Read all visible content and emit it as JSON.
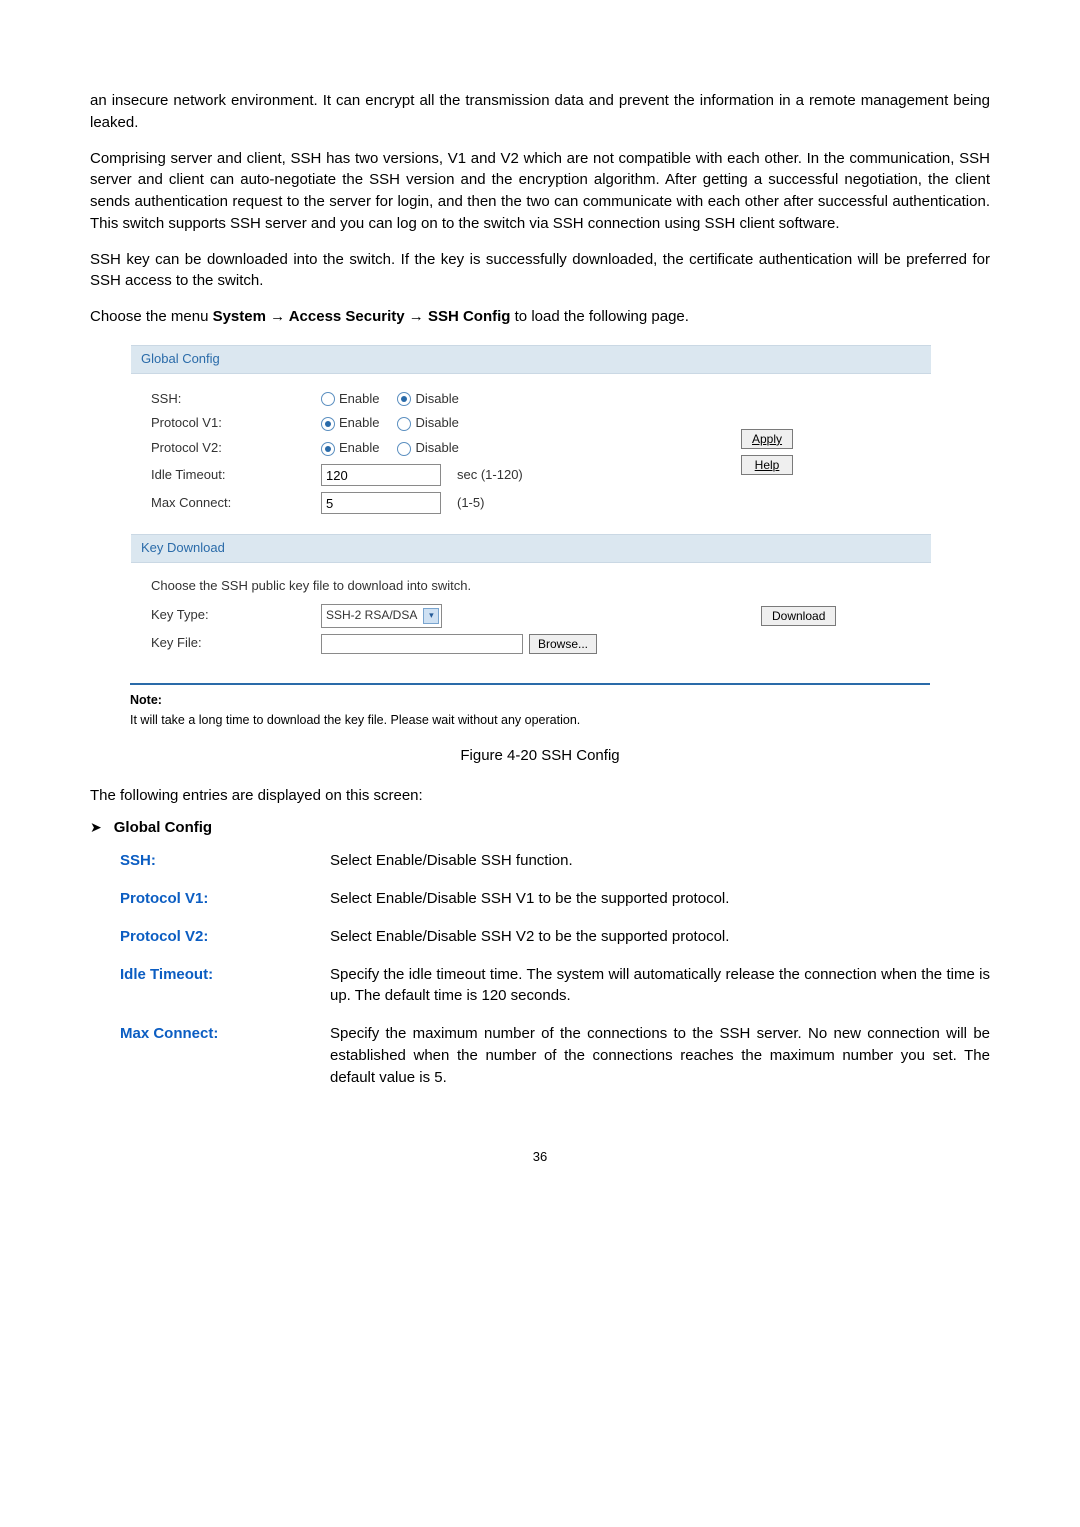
{
  "intro": {
    "p1": "an insecure network environment. It can encrypt all the transmission data and prevent the information in a remote management being leaked.",
    "p2": "Comprising server and client, SSH has two versions, V1 and V2 which are not compatible with each other. In the communication, SSH server and client can auto-negotiate the SSH version and the encryption algorithm. After getting a successful negotiation, the client sends authentication request to the server for login, and then the two can communicate with each other after successful authentication. This switch supports SSH server and you can log on to the switch via SSH connection using SSH client software.",
    "p3": "SSH key can be downloaded into the switch. If the key is successfully downloaded, the certificate authentication will be preferred for SSH access to the switch.",
    "menu_prefix": "Choose the menu ",
    "menu_path": "System → Access Security → SSH Config",
    "menu_suffix": " to load the following page."
  },
  "panel_global": {
    "title": "Global Config",
    "rows": {
      "ssh_label": "SSH:",
      "v1_label": "Protocol V1:",
      "v2_label": "Protocol V2:",
      "idle_label": "Idle Timeout:",
      "max_label": "Max Connect:"
    },
    "enable": "Enable",
    "disable": "Disable",
    "ssh_selected": "disable",
    "v1_selected": "enable",
    "v2_selected": "enable",
    "idle_value": "120",
    "idle_suffix": "sec (1-120)",
    "max_value": "5",
    "max_suffix": "(1-5)",
    "apply": "Apply",
    "help": "Help"
  },
  "panel_key": {
    "title": "Key Download",
    "instruction": "Choose the SSH public key file to download into switch.",
    "keytype_label": "Key Type:",
    "keytype_value": "SSH-2 RSA/DSA",
    "keyfile_label": "Key File:",
    "browse": "Browse...",
    "download": "Download"
  },
  "note": {
    "title": "Note:",
    "text": "It will take a long time to download the key file. Please wait without any operation."
  },
  "figure_caption": "Figure 4-20 SSH Config",
  "entries_intro": "The following entries are displayed on this screen:",
  "bullet_heading": "Global Config",
  "definitions": [
    {
      "term": "SSH:",
      "desc": "Select Enable/Disable SSH function."
    },
    {
      "term": "Protocol V1:",
      "desc": "Select Enable/Disable SSH V1 to be the supported protocol."
    },
    {
      "term": "Protocol V2:",
      "desc": "Select Enable/Disable SSH V2 to be the supported protocol."
    },
    {
      "term": "Idle Timeout:",
      "desc": "Specify the idle timeout time. The system will automatically release the connection when the time is up. The default time is 120 seconds."
    },
    {
      "term": "Max Connect:",
      "desc": "Specify the maximum number of the connections to the SSH server. No new connection will be established when the number of the connections reaches the maximum number you set. The default value is 5."
    }
  ],
  "page_number": "36"
}
